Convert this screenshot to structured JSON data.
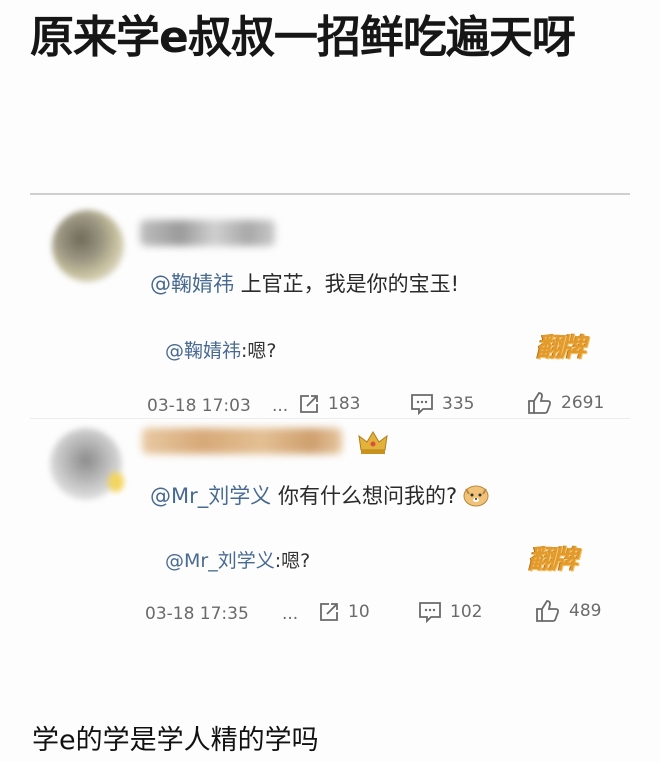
{
  "title": "原来学e叔叔一招鲜吃遍天呀",
  "comments": [
    {
      "mention": "@鞠婧祎",
      "text": " 上官芷，我是你的宝玉!",
      "reply_mention": "@鞠婧祎",
      "reply_text": ":嗯?",
      "flip_label": "翻牌",
      "time": "03-18 17:03",
      "dots": "...",
      "shares": "183",
      "comments": "335",
      "likes": "2691"
    },
    {
      "mention": "@Mr_刘学义",
      "text": " 你有什么想问我的?",
      "emoji_icon": "doge-icon",
      "reply_mention": "@Mr_刘学义",
      "reply_text": ":嗯?",
      "flip_label": "翻牌",
      "time": "03-18 17:35",
      "dots": "...",
      "shares": "10",
      "comments": "102",
      "likes": "489"
    }
  ],
  "caption": "学e的学是学人精的学吗",
  "colors": {
    "mention": "#486a92",
    "flip": "#e29a2c",
    "meta": "#6a6a6a"
  }
}
